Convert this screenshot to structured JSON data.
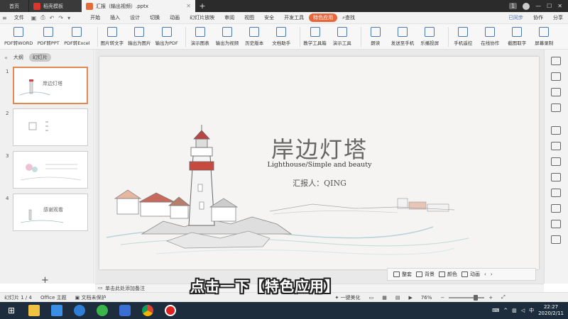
{
  "tabs": {
    "home": "首页",
    "template": "稻壳模板",
    "document": "汇报（输出视频）.pptx",
    "new_tab": "+",
    "badge": "1"
  },
  "menu": {
    "file": "文件",
    "items": [
      "开始",
      "插入",
      "设计",
      "切换",
      "动画",
      "幻灯片放映",
      "审阅",
      "视图",
      "安全",
      "开发工具"
    ],
    "special": "特色应用",
    "search": "查找",
    "sync": "已同步",
    "collab": "协作",
    "share": "分享"
  },
  "ribbon": [
    "PDF转WORD",
    "PDF转PPT",
    "PDF转Excel",
    "图片转文字",
    "输出为图片",
    "输出为PDF",
    "演示图表",
    "输出为视频",
    "历史版本",
    "文档助手",
    "教学工具箱",
    "演示工具",
    "朗读",
    "发送至手机",
    "乐播投屏",
    "手机遥控",
    "在线协作",
    "截图取字",
    "屏幕录制"
  ],
  "left_panel": {
    "tab_outline": "大纲",
    "tab_slides": "幻灯片",
    "thumbs": [
      {
        "num": "1",
        "title": "岸边灯塔"
      },
      {
        "num": "2",
        "title": ""
      },
      {
        "num": "3",
        "title": ""
      },
      {
        "num": "4",
        "title": "感谢观看"
      }
    ],
    "add": "+"
  },
  "slide": {
    "title": "岸边灯塔",
    "subtitle": "Lighthouse/Simple and beauty",
    "reporter": "汇报人：QING"
  },
  "floatbar": [
    "整套",
    "背景",
    "颜色",
    "动画"
  ],
  "notes": "单击此处添加备注",
  "status": {
    "slide_count": "幻灯片 1 / 4",
    "theme": "Office 主题",
    "protect": "文档未保护",
    "beautify": "一键美化",
    "zoom": "76%"
  },
  "caption": "点击一下【特色应用】",
  "clock": {
    "time": "22:27",
    "date": "2020/2/11"
  },
  "ime": "中"
}
